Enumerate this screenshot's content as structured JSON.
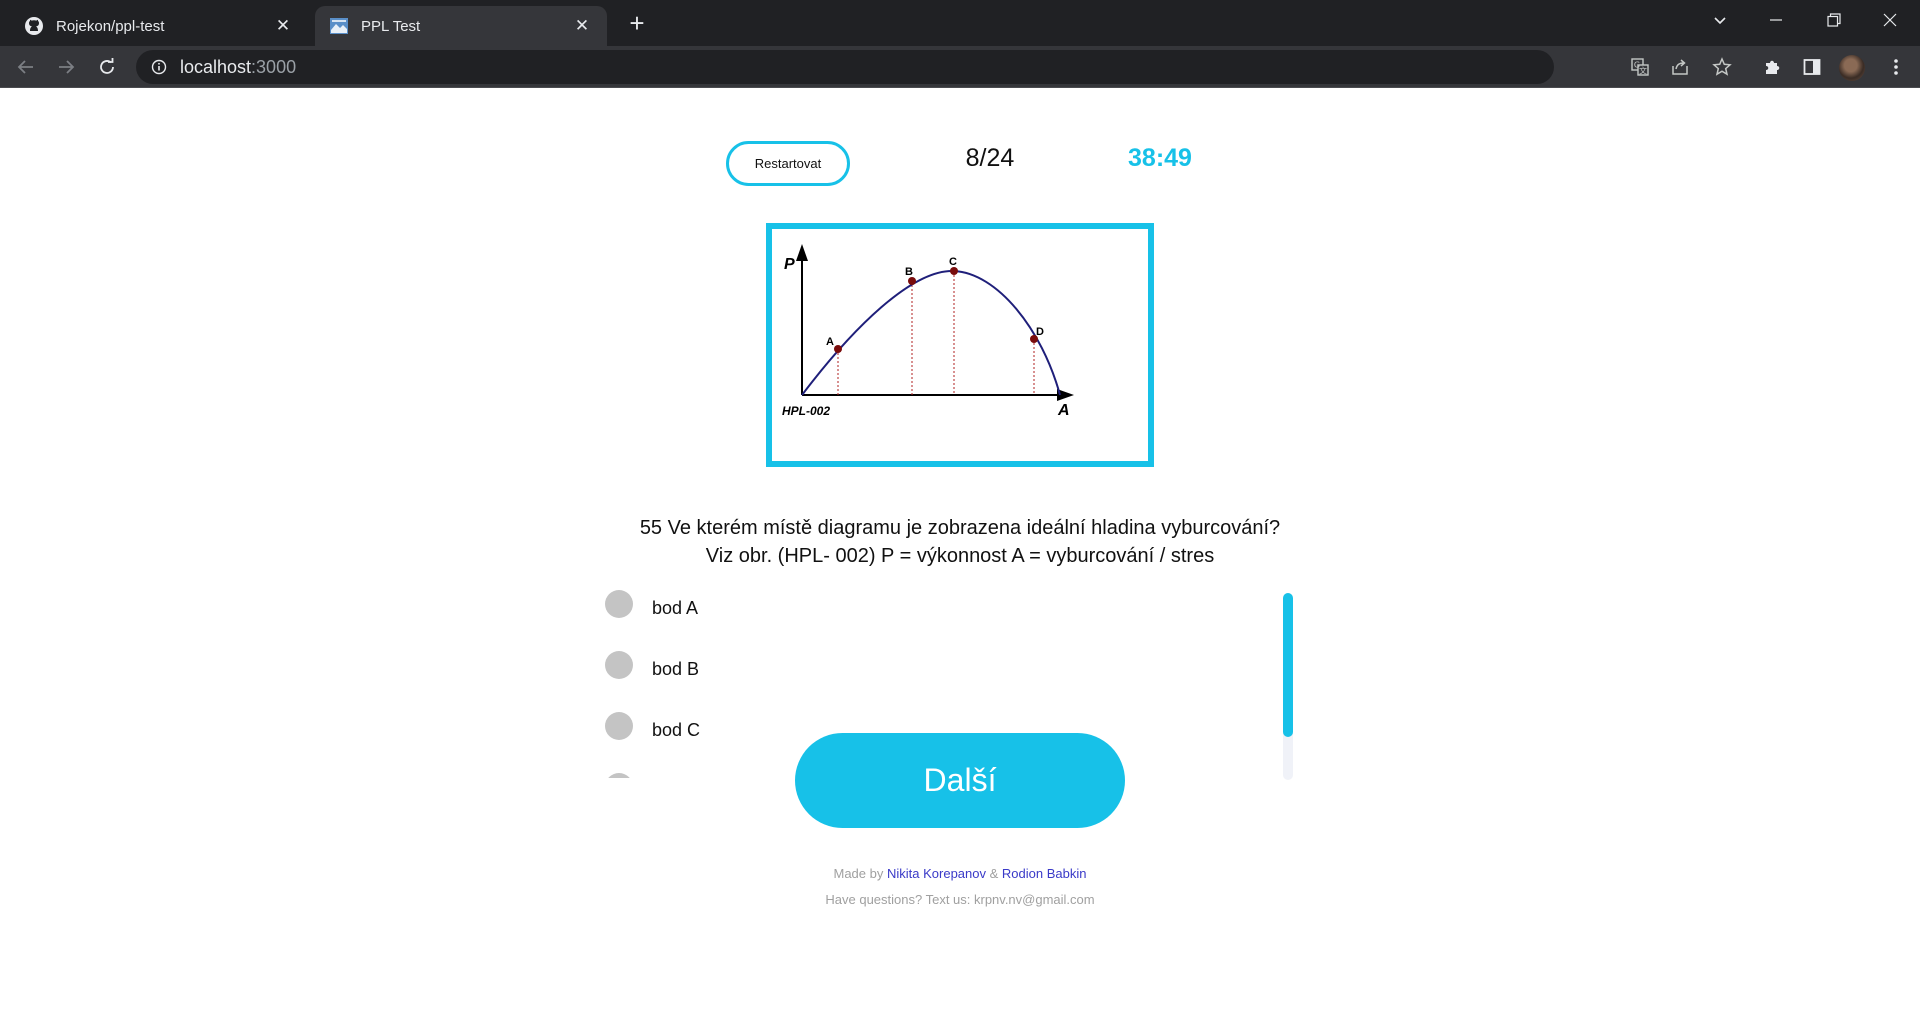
{
  "browser": {
    "tabs": [
      {
        "title": "Rojekon/ppl-test",
        "icon": "github-icon"
      },
      {
        "title": "PPL Test",
        "icon": "site-favicon"
      }
    ],
    "url_host": "localhost",
    "url_rest": ":3000"
  },
  "quiz": {
    "restart_label": "Restartovat",
    "progress": "8/24",
    "timer": "38:49",
    "question_line1": "55 Ve kterém místě diagramu je zobrazena ideální hladina vyburcování?",
    "question_line2": "Viz obr. (HPL- 002) P = výkonnost A = vyburcování / stres",
    "answers": [
      "bod A",
      "bod B",
      "bod C"
    ],
    "next_label": "Další"
  },
  "figure": {
    "y_axis_label": "P",
    "x_axis_label": "A",
    "code": "HPL-002",
    "points": [
      "A",
      "B",
      "C",
      "D"
    ],
    "curve_color": "#1f1f7a",
    "point_color": "#7a0c0c"
  },
  "footer": {
    "made_by": "Made by",
    "author1": "Nikita Korepanov",
    "amp": "&",
    "author2": "Rodion Babkin",
    "contact": "Have questions? Text us: krpnv.nv@gmail.com"
  },
  "colors": {
    "accent": "#17c1e8"
  }
}
